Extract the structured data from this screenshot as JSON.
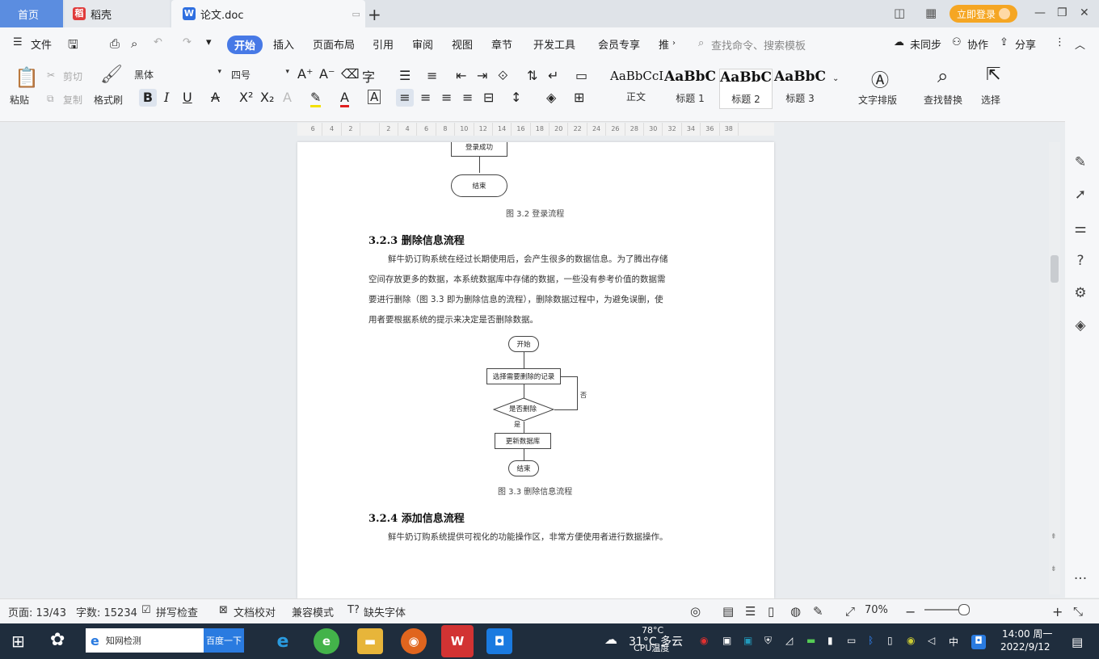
{
  "tabs": {
    "home": "首页",
    "daoke": "稻壳",
    "doc": "论文.doc",
    "login": "立即登录"
  },
  "menu": {
    "file": "文件",
    "items": [
      "开始",
      "插入",
      "页面布局",
      "引用",
      "审阅",
      "视图",
      "章节",
      "开发工具",
      "会员专享",
      "推"
    ],
    "search_placeholder": "查找命令、搜索模板",
    "sync": "未同步",
    "collab": "协作",
    "share": "分享"
  },
  "ribbon": {
    "paste": "粘贴",
    "cut": "剪切",
    "copy": "复制",
    "format_painter": "格式刷",
    "font_name": "黑体",
    "font_size": "四号",
    "styles": [
      {
        "sample": "AaBbCcI",
        "name": "正文"
      },
      {
        "sample": "AaBbC",
        "name": "标题 1"
      },
      {
        "sample": "AaBbC",
        "name": "标题 2"
      },
      {
        "sample": "AaBbC",
        "name": "标题 3"
      }
    ],
    "text_layout": "文字排版",
    "find_replace": "查找替换",
    "select": "选择"
  },
  "ruler": {
    "ticks": [
      "6",
      "4",
      "2",
      "",
      "2",
      "4",
      "6",
      "8",
      "10",
      "12",
      "14",
      "16",
      "18",
      "20",
      "22",
      "24",
      "26",
      "28",
      "30",
      "32",
      "34",
      "36",
      "38"
    ]
  },
  "document": {
    "top_box": "登录成功",
    "top_end": "结束",
    "fig32_caption": "图 3.2  登录流程",
    "h323": "3.2.3  删除信息流程",
    "para1": [
      "鲜牛奶订购系统在经过长期使用后，会产生很多的数据信息。为了腾出存储",
      "空间存放更多的数据，本系统数据库中存储的数据，一些没有参考价值的数据需",
      "要进行删除（图 3.3 即为删除信息的流程），删除数据过程中，为避免误删，使",
      "用者要根据系统的提示来决定是否删除数据。"
    ],
    "flow": {
      "start": "开始",
      "select": "选择需要删除的记录",
      "decide": "是否删除",
      "no": "否",
      "yes": "是",
      "update": "更新数据库",
      "end": "结束"
    },
    "fig33_caption": "图 3.3  删除信息流程",
    "h324": "3.2.4  添加信息流程",
    "para2": "鲜牛奶订购系统提供可视化的功能操作区，非常方便使用者进行数据操作。"
  },
  "status": {
    "page": "页面: 13/43",
    "words": "字数: 15234",
    "spell": "拼写检查",
    "proof": "文档校对",
    "compat": "兼容模式",
    "missing_font": "缺失字体",
    "zoom": "70%"
  },
  "taskbar": {
    "search_text": "知网检测",
    "search_button": "百度一下",
    "weather_temp": "31°C 多云",
    "cpu_temp": "78°C",
    "cpu_label": "CPU温度",
    "ime": "中",
    "time": "14:00 周一",
    "date": "2022/9/12"
  },
  "colors": {
    "accent": "#4779e6",
    "login": "#f5a623",
    "taskbar": "#1f2d3d"
  }
}
